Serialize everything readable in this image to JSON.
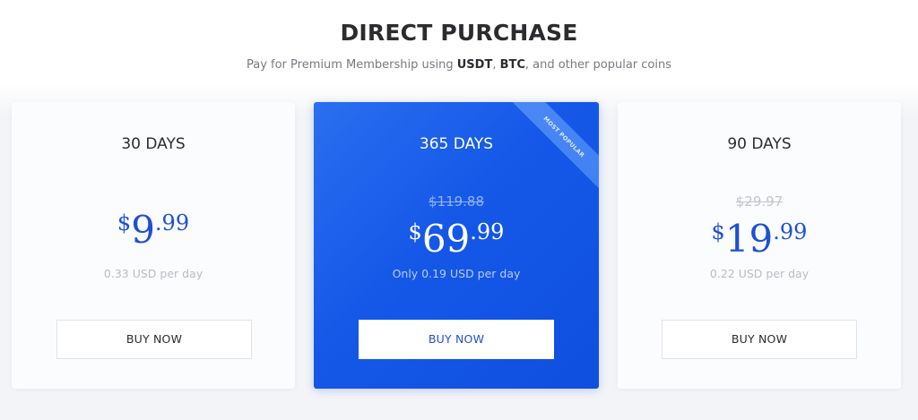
{
  "header": {
    "title": "DIRECT PURCHASE",
    "subtitle_prefix": "Pay for Premium Membership using ",
    "coin_1": "USDT",
    "separator": ", ",
    "coin_2": "BTC",
    "subtitle_suffix": ", and other popular coins"
  },
  "plans": [
    {
      "name": "30 DAYS",
      "old_price": "",
      "currency": "$",
      "price_main": "9",
      "price_cents": ".99",
      "per_day": "0.33 USD per day",
      "button_label": "BUY NOW"
    },
    {
      "name": "365 DAYS",
      "badge": "MOST POPULAR",
      "old_price": "$119.88",
      "currency": "$",
      "price_main": "69",
      "price_cents": ".99",
      "per_day": "Only 0.19 USD per day",
      "button_label": "BUY NOW"
    },
    {
      "name": "90 DAYS",
      "old_price": "$29.97",
      "currency": "$",
      "price_main": "19",
      "price_cents": ".99",
      "per_day": "0.22 USD per day",
      "button_label": "BUY NOW"
    }
  ],
  "colors": {
    "accent": "#1f4fd6",
    "featured_bg": "#1558e8",
    "title": "#2b2c30",
    "muted": "#b9bcc2"
  }
}
